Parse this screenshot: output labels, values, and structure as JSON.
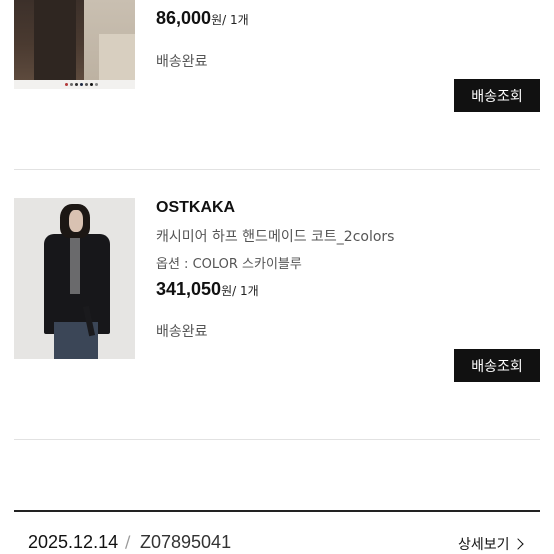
{
  "orders": [
    {
      "price": "86,000",
      "qty_suffix": "원/ 1개",
      "status": "배송완료",
      "track_button": "배송조회",
      "swatch_colors": [
        "#b33a3a",
        "#6b6b6b",
        "#2f2f2f",
        "#1e2a44",
        "#555555",
        "#111111",
        "#8a8a8a"
      ]
    },
    {
      "brand": "OSTKAKA",
      "product_name": "캐시미어 하프 핸드메이드 코트_2colors",
      "option": "옵션 : COLOR 스카이블루",
      "price": "341,050",
      "qty_suffix": "원/ 1개",
      "status": "배송완료",
      "track_button": "배송조회"
    }
  ],
  "next_order": {
    "date": "2025.12.14",
    "separator": "/",
    "order_number": "Z07895041",
    "detail_link": "상세보기"
  }
}
